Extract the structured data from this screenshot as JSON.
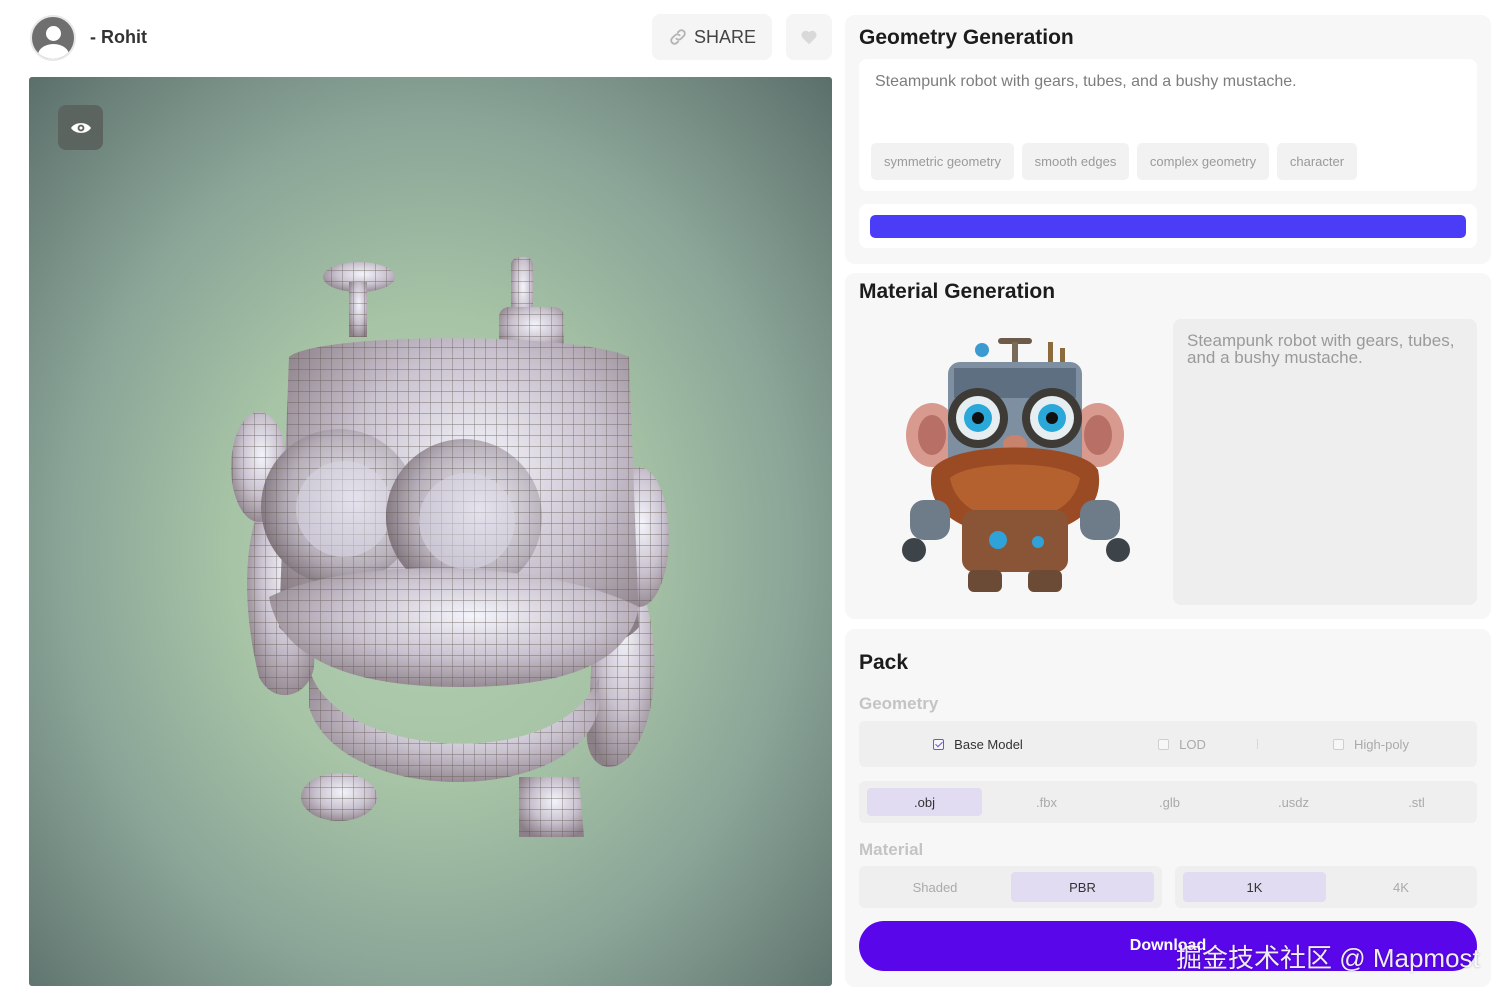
{
  "header": {
    "username": "- Rohit",
    "share_label": "SHARE"
  },
  "icons": {
    "avatar": "avatar-icon",
    "share": "link-icon",
    "like": "heart-icon",
    "viewer_toggle": "eye-icon"
  },
  "geometry": {
    "title": "Geometry Generation",
    "prompt": "Steampunk robot with gears, tubes, and a bushy mustache.",
    "tags": [
      "symmetric geometry",
      "smooth edges",
      "complex geometry",
      "character"
    ],
    "progress_percent": 100
  },
  "material": {
    "title": "Material Generation",
    "prompt": "Steampunk robot with gears, tubes, and a bushy mustache."
  },
  "pack": {
    "title": "Pack",
    "geometry_label": "Geometry",
    "model_options": [
      {
        "label": "Base Model",
        "checked": true
      },
      {
        "label": "LOD",
        "checked": false
      },
      {
        "label": "High-poly",
        "checked": false
      }
    ],
    "formats": [
      {
        "label": ".obj",
        "active": true
      },
      {
        "label": ".fbx",
        "active": false
      },
      {
        "label": ".glb",
        "active": false
      },
      {
        "label": ".usdz",
        "active": false
      },
      {
        "label": ".stl",
        "active": false
      }
    ],
    "material_label": "Material",
    "shading": [
      {
        "label": "Shaded",
        "active": false
      },
      {
        "label": "PBR",
        "active": true
      }
    ],
    "resolution": [
      {
        "label": "1K",
        "active": true
      },
      {
        "label": "4K",
        "active": false
      }
    ],
    "download_label": "Download"
  },
  "watermark": "掘金技术社区 @ Mapmost",
  "colors": {
    "accent": "#5a06eb",
    "progress": "#4a3cf7",
    "selected_option": "#e1dcf2"
  }
}
